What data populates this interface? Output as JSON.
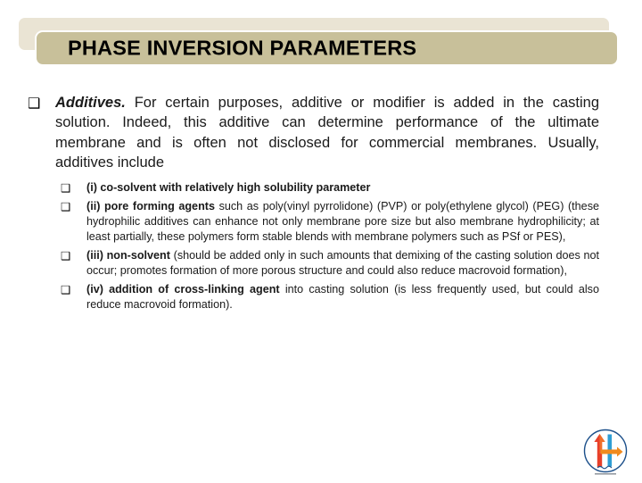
{
  "slide": {
    "title": "PHASE INVERSION PARAMETERS",
    "colors": {
      "title_bar": "#c8c09a",
      "title_backdrop": "#eae4d4",
      "text": "#1a1a1a",
      "logo_red": "#e8402a",
      "logo_orange": "#f08a1e",
      "logo_blue": "#2f9ed4",
      "logo_dark_blue": "#1b4f8a"
    },
    "bullet_glyph": "❑"
  },
  "main_bullet": {
    "marker": "❑",
    "lead": "Additives.",
    "body": " For certain purposes, additive or modifier is added in the casting solution. Indeed, this additive can determine performance of the ultimate membrane and is often not disclosed for commercial membranes. Usually, additives include"
  },
  "sub_bullets": [
    {
      "marker": "❑",
      "lead": "(i) co-solvent with relatively high solubility parameter",
      "body": ""
    },
    {
      "marker": "❑",
      "lead": "(ii) pore forming agents",
      "body": " such as poly(vinyl pyrrolidone) (PVP) or poly(ethylene glycol) (PEG) (these hydrophilic additives can enhance not only membrane pore size but also membrane hydrophilicity; at least partially, these polymers form stable blends with membrane polymers such as PSf or PES),"
    },
    {
      "marker": "❑",
      "lead": "(iii) non-solvent",
      "body": " (should be added only in such amounts that demixing of the casting solution does not occur; promotes formation of more porous structure and could also reduce macrovoid formation),"
    },
    {
      "marker": "❑",
      "lead": "(iv) addition of cross-linking agent",
      "body": " into casting solution (is less frequently used, but could also reduce macrovoid formation)."
    }
  ],
  "logo": {
    "name": "institution-logo",
    "caption": ""
  }
}
